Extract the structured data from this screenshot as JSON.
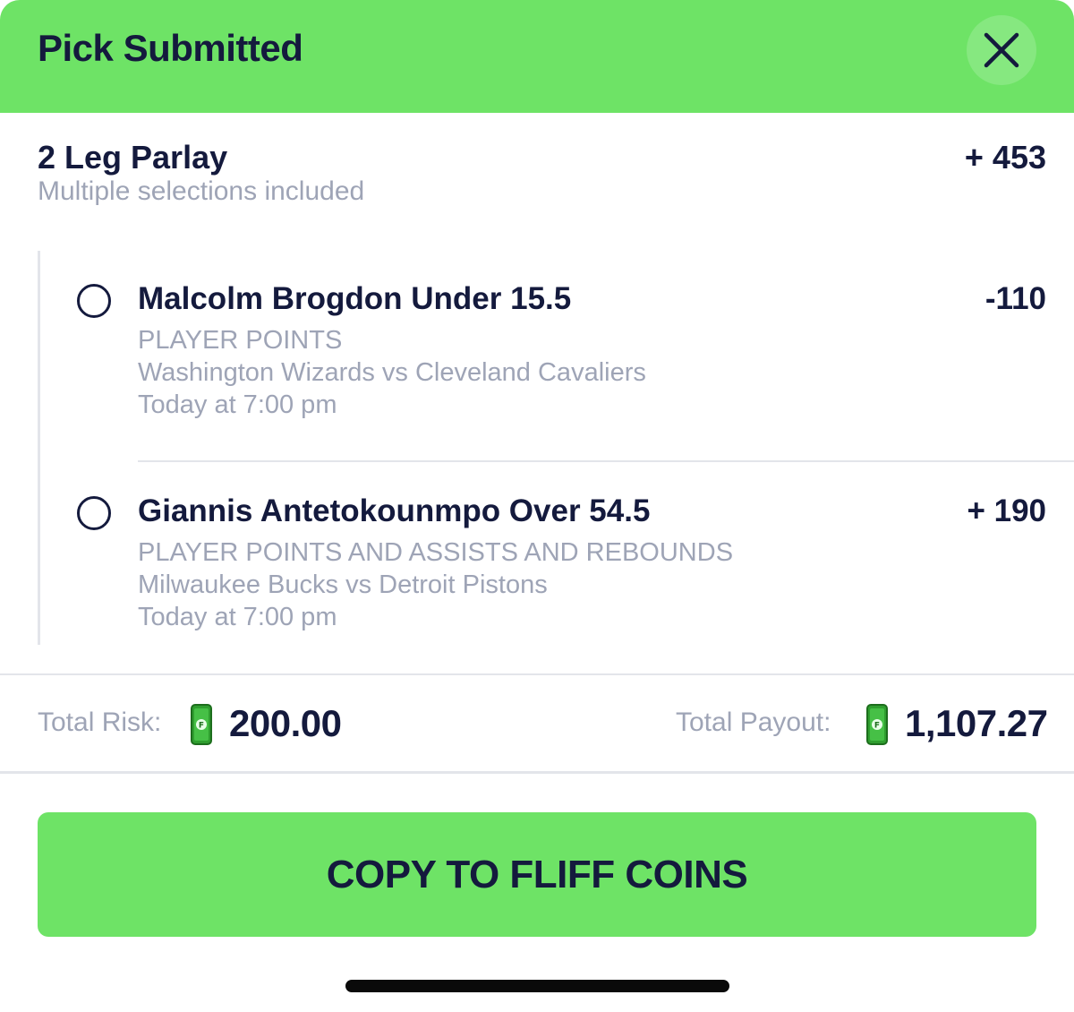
{
  "header": {
    "title": "Pick Submitted",
    "close_icon": "close-icon",
    "color": "#6ee366"
  },
  "parlay": {
    "title": "2 Leg Parlay",
    "subtitle": "Multiple selections included",
    "odds": "+ 453"
  },
  "legs": [
    {
      "title": "Malcolm Brogdon Under 15.5",
      "odds": "-110",
      "market": "PLAYER POINTS",
      "matchup": "Washington Wizards vs Cleveland Cavaliers",
      "time": "Today at 7:00 pm"
    },
    {
      "title": "Giannis Antetokounmpo Over 54.5",
      "odds": "+ 190",
      "market": "PLAYER POINTS AND ASSISTS AND REBOUNDS",
      "matchup": "Milwaukee Bucks vs Detroit Pistons",
      "time": "Today at 7:00 pm"
    }
  ],
  "totals": {
    "risk_label": "Total Risk:",
    "risk_value": "200.00",
    "payout_label": "Total Payout:",
    "payout_value": "1,107.27",
    "currency_icon": "cash-coin-icon"
  },
  "copy_button": {
    "label": "COPY TO FLIFF COINS"
  },
  "colors": {
    "accent": "#6ee366",
    "text_primary": "#141a3d",
    "text_muted": "#9ea4b6",
    "divider": "#e3e5ea"
  }
}
